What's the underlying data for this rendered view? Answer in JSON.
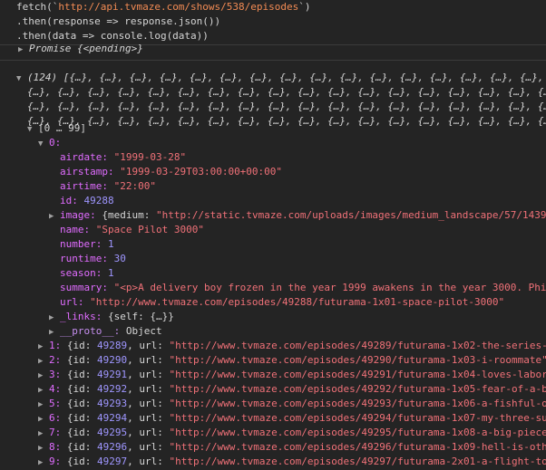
{
  "code": {
    "line1_prefix": "fetch(`",
    "line1_url": "http://api.tvmaze.com/shows/538/episodes",
    "line1_suffix": "`)",
    "line2": ".then(response => response.json())",
    "line3": ".then(data => console.log(data))"
  },
  "promise": {
    "label": "Promise",
    "state": "{<pending>}"
  },
  "array": {
    "count": "(124)",
    "summary_lines": [
      "[{…}, {…}, {…}, {…}, {…}, {…}, {…}, {…}, {…}, {…}, {…}, {…}, {…}, {…}, {…}, {…}, {…}, {…}",
      "{…}, {…}, {…}, {…}, {…}, {…}, {…}, {…}, {…}, {…}, {…}, {…}, {…}, {…}, {…}, {…}, {…}, {…}",
      "{…}, {…}, {…}, {…}, {…}, {…}, {…}, {…}, {…}, {…}, {…}, {…}, {…}, {…}, {…}, {…}, {…}, {…}",
      "{…}, {…}, {…}, {…}, {…}, {…}, {…}, {…}, {…}, {…}, {…}, {…}, {…}, {…}, {…}, {…}, {…}, {…}",
      "{…}, {…}, {…}, {…}, {…}, {…}, {…}, {…}, {…}, {…}, {…}, {…}, {…}, {…}, {…}, {…}, {…}, {…}"
    ],
    "range": "[0 … 99]",
    "first_index": "0:"
  },
  "episode0": {
    "airdate_key": "airdate:",
    "airdate": "\"1999-03-28\"",
    "airstamp_key": "airstamp:",
    "airstamp": "\"1999-03-29T03:00:00+00:00\"",
    "airtime_key": "airtime:",
    "airtime": "\"22:00\"",
    "id_key": "id:",
    "id": "49288",
    "image_key": "image:",
    "image_val_prefix": "{medium: ",
    "image_val": "\"http://static.tvmaze.com/uploads/images/medium_landscape/57/1439",
    "name_key": "name:",
    "name": "\"Space Pilot 3000\"",
    "number_key": "number:",
    "number": "1",
    "runtime_key": "runtime:",
    "runtime": "30",
    "season_key": "season:",
    "season": "1",
    "summary_key": "summary:",
    "summary": "\"<p>A delivery boy frozen in the year 1999 awakens in the year 3000. Phi",
    "url_key": "url:",
    "url": "\"http://www.tvmaze.com/episodes/49288/futurama-1x01-space-pilot-3000\"",
    "links_key": "_links:",
    "links": "{self: {…}}",
    "proto_key": "__proto__:",
    "proto": "Object"
  },
  "episodes": [
    {
      "idx": "1:",
      "id": "49289",
      "url": "\"http://www.tvmaze.com/episodes/49289/futurama-1x02-the-series-"
    },
    {
      "idx": "2:",
      "id": "49290",
      "url": "\"http://www.tvmaze.com/episodes/49290/futurama-1x03-i-roommate\""
    },
    {
      "idx": "3:",
      "id": "49291",
      "url": "\"http://www.tvmaze.com/episodes/49291/futurama-1x04-loves-labor"
    },
    {
      "idx": "4:",
      "id": "49292",
      "url": "\"http://www.tvmaze.com/episodes/49292/futurama-1x05-fear-of-a-b"
    },
    {
      "idx": "5:",
      "id": "49293",
      "url": "\"http://www.tvmaze.com/episodes/49293/futurama-1x06-a-fishful-o"
    },
    {
      "idx": "6:",
      "id": "49294",
      "url": "\"http://www.tvmaze.com/episodes/49294/futurama-1x07-my-three-su"
    },
    {
      "idx": "7:",
      "id": "49295",
      "url": "\"http://www.tvmaze.com/episodes/49295/futurama-1x08-a-big-piece"
    },
    {
      "idx": "8:",
      "id": "49296",
      "url": "\"http://www.tvmaze.com/episodes/49296/futurama-1x09-hell-is-oth"
    },
    {
      "idx": "9:",
      "id": "49297",
      "url": "\"http://www.tvmaze.com/episodes/49297/futurama-2x01-a-flight-to"
    }
  ],
  "labels": {
    "id_key": "{id:",
    "url_key": "url:",
    "comma": ","
  }
}
